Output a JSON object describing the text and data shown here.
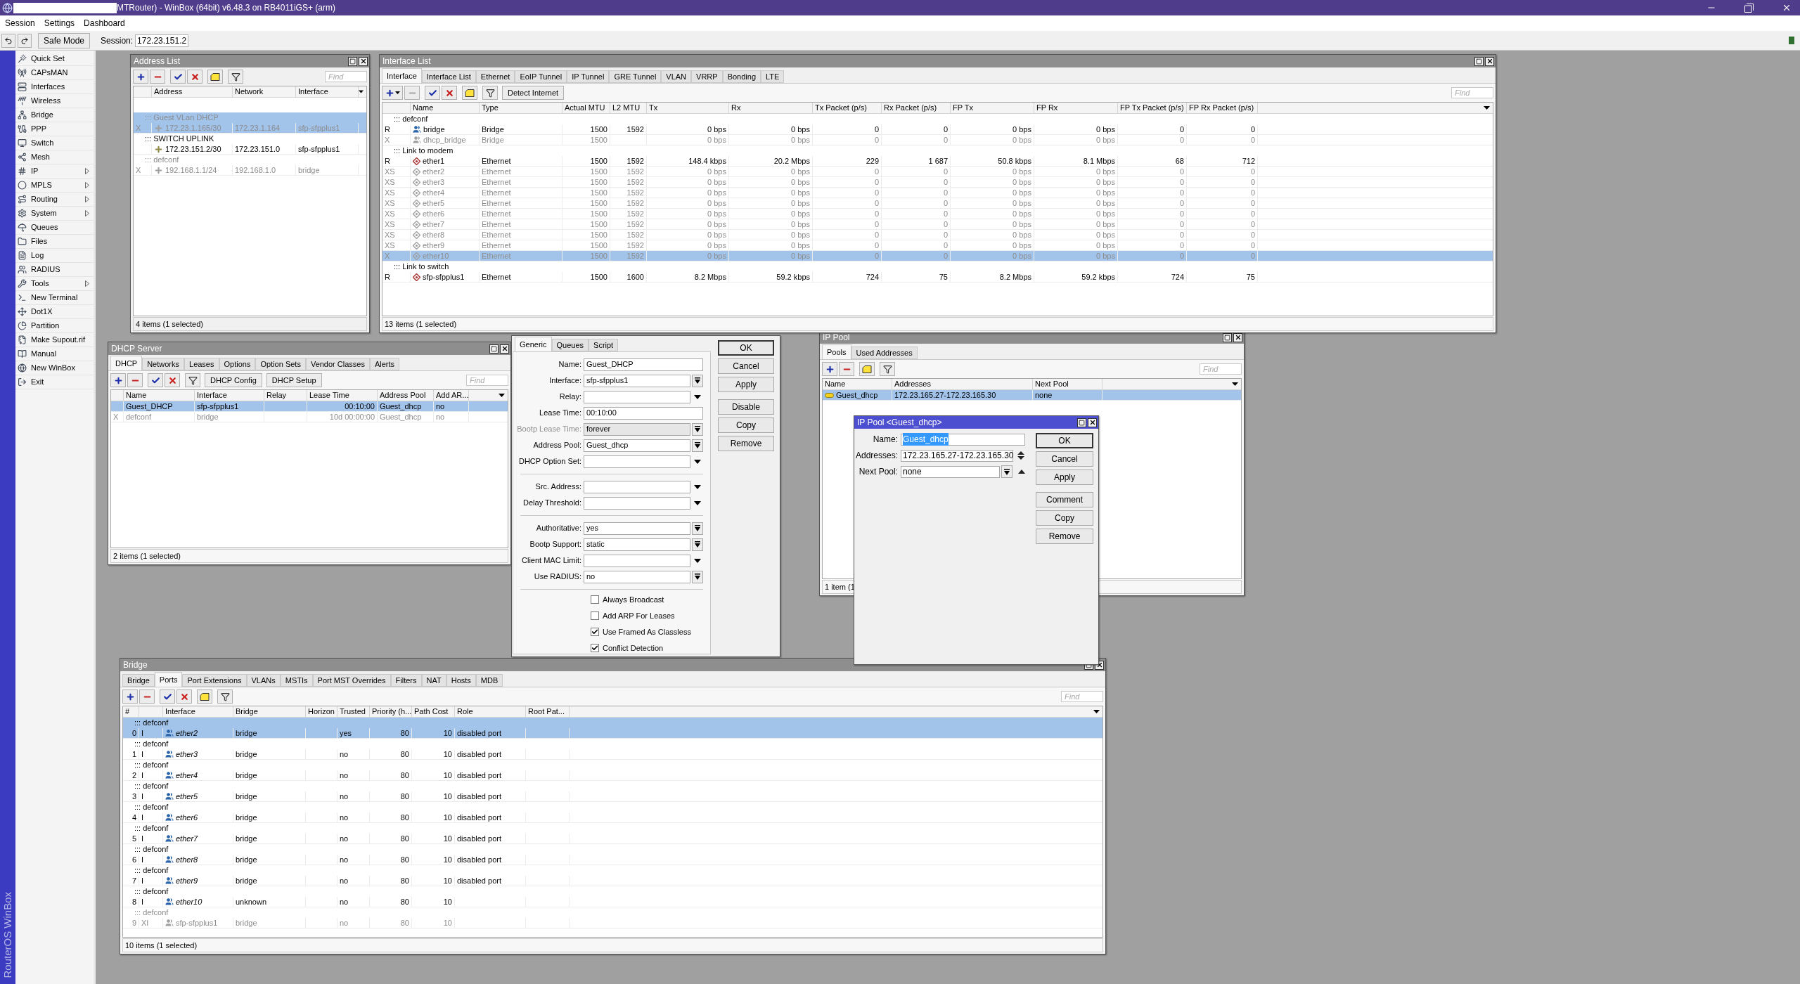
{
  "window": {
    "title": "MTRouter) - WinBox (64bit) v6.48.3 on RB4011iGS+ (arm)"
  },
  "menu": [
    "Session",
    "Settings",
    "Dashboard"
  ],
  "toolbar": {
    "safe_mode": "Safe Mode",
    "session_label": "Session:",
    "session": "172.23.151.2"
  },
  "sidebar": {
    "brand": "RouterOS WinBox",
    "items": [
      {
        "label": "Quick Set",
        "submenu": false
      },
      {
        "label": "CAPsMAN",
        "submenu": false
      },
      {
        "label": "Interfaces",
        "submenu": false
      },
      {
        "label": "Wireless",
        "submenu": false
      },
      {
        "label": "Bridge",
        "submenu": false
      },
      {
        "label": "PPP",
        "submenu": false
      },
      {
        "label": "Switch",
        "submenu": false
      },
      {
        "label": "Mesh",
        "submenu": false
      },
      {
        "label": "IP",
        "submenu": true
      },
      {
        "label": "MPLS",
        "submenu": true
      },
      {
        "label": "Routing",
        "submenu": true
      },
      {
        "label": "System",
        "submenu": true
      },
      {
        "label": "Queues",
        "submenu": false
      },
      {
        "label": "Files",
        "submenu": false
      },
      {
        "label": "Log",
        "submenu": false
      },
      {
        "label": "RADIUS",
        "submenu": false
      },
      {
        "label": "Tools",
        "submenu": true
      },
      {
        "label": "New Terminal",
        "submenu": false
      },
      {
        "label": "Dot1X",
        "submenu": false
      },
      {
        "label": "Partition",
        "submenu": false
      },
      {
        "label": "Make Supout.rif",
        "submenu": false
      },
      {
        "label": "Manual",
        "submenu": false
      },
      {
        "label": "New WinBox",
        "submenu": false
      },
      {
        "label": "Exit",
        "submenu": false
      }
    ]
  },
  "address_list": {
    "title": "Address List",
    "tools": [
      {
        "kind": "add",
        "disabled": false
      },
      {
        "kind": "remove",
        "disabled": false
      },
      {
        "kind": "enable",
        "disabled": false
      },
      {
        "kind": "disable",
        "disabled": false
      },
      {
        "kind": "comment",
        "disabled": false
      },
      {
        "kind": "filter",
        "disabled": false
      }
    ],
    "find": {
      "placeholder": "Find"
    },
    "table": {
      "columns": [
        "Address",
        "Network",
        "Interface"
      ],
      "rows": [
        {
          "kind": "address",
          "flag": "X",
          "comment": "::: Guest VLan DHCP",
          "cells": [
            "172.23.1.165/30",
            "172.23.1.164",
            "sfp-sfpplus1"
          ],
          "selected": true,
          "disabled": true
        },
        {
          "kind": "address",
          "comment": "::: SWITCH UPLINK",
          "cells": [
            "172.23.151.2/30",
            "172.23.151.0",
            "sfp-sfpplus1"
          ],
          "selected": false,
          "disabled": false
        },
        {
          "kind": "address",
          "flag": "X",
          "comment": "::: defconf",
          "cells": [
            "192.168.1.1/24",
            "192.168.1.0",
            "bridge"
          ],
          "selected": false,
          "disabled": true
        }
      ]
    },
    "status": "4 items (1 selected)"
  },
  "interface_list": {
    "title": "Interface List",
    "tabs": [
      {
        "label": "Interface",
        "selected": true
      },
      {
        "label": "Interface List",
        "selected": false
      },
      {
        "label": "Ethernet",
        "selected": false
      },
      {
        "label": "EoIP Tunnel",
        "selected": false
      },
      {
        "label": "IP Tunnel",
        "selected": false
      },
      {
        "label": "GRE Tunnel",
        "selected": false
      },
      {
        "label": "VLAN",
        "selected": false
      },
      {
        "label": "VRRP",
        "selected": false
      },
      {
        "label": "Bonding",
        "selected": false
      },
      {
        "label": "LTE",
        "selected": false
      }
    ],
    "tools": [
      {
        "kind": "add-menu",
        "disabled": false
      },
      {
        "kind": "remove",
        "disabled": true
      },
      {
        "kind": "enable",
        "disabled": false
      },
      {
        "kind": "disable",
        "disabled": false
      },
      {
        "kind": "comment",
        "disabled": false
      },
      {
        "kind": "filter",
        "disabled": false
      }
    ],
    "buttons": [
      "Detect Internet"
    ],
    "find": {
      "placeholder": "Find"
    },
    "table": {
      "columns": [
        "Name",
        "Type",
        "Actual MTU",
        "L2 MTU",
        "Tx",
        "Rx",
        "Tx Packet (p/s)",
        "Rx Packet (p/s)",
        "FP Tx",
        "FP Rx",
        "FP Tx Packet (p/s)",
        "FP Rx Packet (p/s)"
      ],
      "rows": [
        {
          "kind": "bridge",
          "flag": "R",
          "comment": "::: defconf",
          "cells": [
            "bridge",
            "Bridge",
            "1500",
            "1592",
            "0 bps",
            "0 bps",
            "0",
            "0",
            "0 bps",
            "0 bps",
            "0",
            "0"
          ],
          "selected": false,
          "disabled": false
        },
        {
          "kind": "bridge",
          "flag": "X",
          "cells": [
            "dhcp_bridge",
            "Bridge",
            "1500",
            null,
            "0 bps",
            "0 bps",
            "0",
            "0",
            "0 bps",
            "0 bps",
            "0",
            "0"
          ],
          "selected": false,
          "disabled": true
        },
        {
          "kind": "ethernet",
          "flag": "R",
          "comment": "::: Link to modem",
          "cells": [
            "ether1",
            "Ethernet",
            "1500",
            "1592",
            "148.4 kbps",
            "20.2 Mbps",
            "229",
            "1 687",
            "50.8 kbps",
            "8.1 Mbps",
            "68",
            "712"
          ],
          "selected": false,
          "disabled": false
        },
        {
          "kind": "ethernet",
          "flag": "XS",
          "cells": [
            "ether2",
            "Ethernet",
            "1500",
            "1592",
            "0 bps",
            "0 bps",
            "0",
            "0",
            "0 bps",
            "0 bps",
            "0",
            "0"
          ],
          "selected": false,
          "disabled": true
        },
        {
          "kind": "ethernet",
          "flag": "XS",
          "cells": [
            "ether3",
            "Ethernet",
            "1500",
            "1592",
            "0 bps",
            "0 bps",
            "0",
            "0",
            "0 bps",
            "0 bps",
            "0",
            "0"
          ],
          "selected": false,
          "disabled": true
        },
        {
          "kind": "ethernet",
          "flag": "XS",
          "cells": [
            "ether4",
            "Ethernet",
            "1500",
            "1592",
            "0 bps",
            "0 bps",
            "0",
            "0",
            "0 bps",
            "0 bps",
            "0",
            "0"
          ],
          "selected": false,
          "disabled": true
        },
        {
          "kind": "ethernet",
          "flag": "XS",
          "cells": [
            "ether5",
            "Ethernet",
            "1500",
            "1592",
            "0 bps",
            "0 bps",
            "0",
            "0",
            "0 bps",
            "0 bps",
            "0",
            "0"
          ],
          "selected": false,
          "disabled": true
        },
        {
          "kind": "ethernet",
          "flag": "XS",
          "cells": [
            "ether6",
            "Ethernet",
            "1500",
            "1592",
            "0 bps",
            "0 bps",
            "0",
            "0",
            "0 bps",
            "0 bps",
            "0",
            "0"
          ],
          "selected": false,
          "disabled": true
        },
        {
          "kind": "ethernet",
          "flag": "XS",
          "cells": [
            "ether7",
            "Ethernet",
            "1500",
            "1592",
            "0 bps",
            "0 bps",
            "0",
            "0",
            "0 bps",
            "0 bps",
            "0",
            "0"
          ],
          "selected": false,
          "disabled": true
        },
        {
          "kind": "ethernet",
          "flag": "XS",
          "cells": [
            "ether8",
            "Ethernet",
            "1500",
            "1592",
            "0 bps",
            "0 bps",
            "0",
            "0",
            "0 bps",
            "0 bps",
            "0",
            "0"
          ],
          "selected": false,
          "disabled": true
        },
        {
          "kind": "ethernet",
          "flag": "XS",
          "cells": [
            "ether9",
            "Ethernet",
            "1500",
            "1592",
            "0 bps",
            "0 bps",
            "0",
            "0",
            "0 bps",
            "0 bps",
            "0",
            "0"
          ],
          "selected": false,
          "disabled": true
        },
        {
          "kind": "ethernet",
          "flag": "X",
          "cells": [
            "ether10",
            "Ethernet",
            "1500",
            "1592",
            "0 bps",
            "0 bps",
            "0",
            "0",
            "0 bps",
            "0 bps",
            "0",
            "0"
          ],
          "selected": true,
          "disabled": true
        },
        {
          "kind": "ethernet",
          "flag": "R",
          "comment": "::: Link to switch",
          "cells": [
            "sfp-sfpplus1",
            "Ethernet",
            "1500",
            "1600",
            "8.2 Mbps",
            "59.2 kbps",
            "724",
            "75",
            "8.2 Mbps",
            "59.2 kbps",
            "724",
            "75"
          ],
          "selected": false,
          "disabled": false
        }
      ]
    },
    "status": "13 items (1 selected)"
  },
  "dhcp_server": {
    "title": "DHCP Server",
    "tabs": [
      {
        "label": "DHCP",
        "selected": true
      },
      {
        "label": "Networks",
        "selected": false
      },
      {
        "label": "Leases",
        "selected": false
      },
      {
        "label": "Options",
        "selected": false
      },
      {
        "label": "Option Sets",
        "selected": false
      },
      {
        "label": "Vendor Classes",
        "selected": false
      },
      {
        "label": "Alerts",
        "selected": false
      }
    ],
    "tools": [
      {
        "kind": "add",
        "disabled": false
      },
      {
        "kind": "remove",
        "disabled": false
      },
      {
        "kind": "enable",
        "disabled": false
      },
      {
        "kind": "disable",
        "disabled": false
      },
      {
        "kind": "filter",
        "disabled": false
      }
    ],
    "buttons": [
      "DHCP Config",
      "DHCP Setup"
    ],
    "find": {
      "placeholder": "Find"
    },
    "table": {
      "columns": [
        "Name",
        "Interface",
        "Relay",
        "Lease Time",
        "Address Pool",
        "Add AR..."
      ],
      "rows": [
        {
          "cells": [
            "Guest_DHCP",
            "sfp-sfpplus1",
            null,
            "00:10:00",
            "Guest_dhcp",
            "no"
          ],
          "selected": true,
          "disabled": false
        },
        {
          "flag": "X",
          "cells": [
            "defconf",
            "bridge",
            null,
            "10d 00:00:00",
            "Guest_dhcp",
            "no"
          ],
          "selected": false,
          "disabled": true
        }
      ]
    },
    "status": "2 items (1 selected)"
  },
  "dhcp_server_dialog": {
    "tabs": [
      {
        "label": "Generic",
        "selected": true
      },
      {
        "label": "Queues",
        "selected": false
      },
      {
        "label": "Script",
        "selected": false
      }
    ],
    "field_groups": [
      [
        {
          "label": "Name:",
          "value": "Guest_DHCP",
          "kind": "text",
          "disabled": false
        },
        {
          "label": "Interface:",
          "value": "sfp-sfpplus1",
          "kind": "combo",
          "disabled": false
        },
        {
          "label": "Relay:",
          "kind": "select",
          "disabled": false
        },
        {
          "label": "Lease Time:",
          "value": "00:10:00",
          "kind": "text",
          "disabled": false
        },
        {
          "label": "Bootp Lease Time:",
          "value": "forever",
          "kind": "combo",
          "disabled": true
        },
        {
          "label": "Address Pool:",
          "value": "Guest_dhcp",
          "kind": "combo",
          "disabled": false
        },
        {
          "label": "DHCP Option Set:",
          "kind": "select",
          "disabled": false
        }
      ],
      [
        {
          "label": "Src. Address:",
          "kind": "select",
          "disabled": false
        },
        {
          "label": "Delay Threshold:",
          "kind": "select",
          "disabled": false
        }
      ],
      [
        {
          "label": "Authoritative:",
          "value": "yes",
          "kind": "combo",
          "disabled": false
        },
        {
          "label": "Bootp Support:",
          "value": "static",
          "kind": "combo",
          "disabled": false
        },
        {
          "label": "Client MAC Limit:",
          "kind": "select",
          "disabled": false
        },
        {
          "label": "Use RADIUS:",
          "value": "no",
          "kind": "combo",
          "disabled": false
        }
      ]
    ],
    "checkboxes": [
      {
        "label": "Always Broadcast",
        "checked": false
      },
      {
        "label": "Add ARP For Leases",
        "checked": false
      },
      {
        "label": "Use Framed As Classless",
        "checked": true
      },
      {
        "label": "Conflict Detection",
        "checked": true
      }
    ],
    "buttons": [
      "OK",
      "Cancel",
      "Apply",
      "Disable",
      "Copy",
      "Remove"
    ]
  },
  "ip_pool": {
    "title": "IP Pool",
    "tabs": [
      {
        "label": "Pools",
        "selected": true
      },
      {
        "label": "Used Addresses",
        "selected": false
      }
    ],
    "tools": [
      {
        "kind": "add",
        "disabled": false
      },
      {
        "kind": "remove",
        "disabled": false
      },
      {
        "kind": "comment",
        "disabled": false
      },
      {
        "kind": "filter",
        "disabled": false
      }
    ],
    "find": {
      "placeholder": "Find"
    },
    "table": {
      "columns": [
        "Name",
        "Addresses",
        "Next Pool"
      ],
      "rows": [
        {
          "kind": "pool",
          "cells": [
            "Guest_dhcp",
            "172.23.165.27-172.23.165.30",
            "none"
          ],
          "selected": true,
          "disabled": false
        }
      ]
    },
    "status": "1 item (1"
  },
  "bridge": {
    "title": "Bridge",
    "tabs": [
      {
        "label": "Bridge",
        "selected": false
      },
      {
        "label": "Ports",
        "selected": true
      },
      {
        "label": "Port Extensions",
        "selected": false
      },
      {
        "label": "VLANs",
        "selected": false
      },
      {
        "label": "MSTIs",
        "selected": false
      },
      {
        "label": "Port MST Overrides",
        "selected": false
      },
      {
        "label": "Filters",
        "selected": false
      },
      {
        "label": "NAT",
        "selected": false
      },
      {
        "label": "Hosts",
        "selected": false
      },
      {
        "label": "MDB",
        "selected": false
      }
    ],
    "tools": [
      {
        "kind": "add",
        "disabled": false
      },
      {
        "kind": "remove",
        "disabled": false
      },
      {
        "kind": "enable",
        "disabled": false
      },
      {
        "kind": "disable",
        "disabled": false
      },
      {
        "kind": "comment",
        "disabled": false
      },
      {
        "kind": "filter",
        "disabled": false
      }
    ],
    "find": {
      "placeholder": "Find"
    },
    "table": {
      "columns": [
        "#",
        "Interface",
        "Bridge",
        "Horizon",
        "Trusted",
        "Priority (h...",
        "Path Cost",
        "Role",
        "Root Pat..."
      ],
      "rows": [
        {
          "kind": "bridge",
          "flag": "I",
          "comment": "::: defconf",
          "cells": [
            "0",
            "ether2",
            "bridge",
            null,
            "yes",
            "80",
            "10",
            "disabled port",
            null
          ],
          "selected": true,
          "disabled": false,
          "inactive": true
        },
        {
          "kind": "bridge",
          "flag": "I",
          "comment": "::: defconf",
          "cells": [
            "1",
            "ether3",
            "bridge",
            null,
            "no",
            "80",
            "10",
            "disabled port",
            null
          ],
          "selected": false,
          "disabled": false,
          "inactive": true
        },
        {
          "kind": "bridge",
          "flag": "I",
          "comment": "::: defconf",
          "cells": [
            "2",
            "ether4",
            "bridge",
            null,
            "no",
            "80",
            "10",
            "disabled port",
            null
          ],
          "selected": false,
          "disabled": false,
          "inactive": true
        },
        {
          "kind": "bridge",
          "flag": "I",
          "comment": "::: defconf",
          "cells": [
            "3",
            "ether5",
            "bridge",
            null,
            "no",
            "80",
            "10",
            "disabled port",
            null
          ],
          "selected": false,
          "disabled": false,
          "inactive": true
        },
        {
          "kind": "bridge",
          "flag": "I",
          "comment": "::: defconf",
          "cells": [
            "4",
            "ether6",
            "bridge",
            null,
            "no",
            "80",
            "10",
            "disabled port",
            null
          ],
          "selected": false,
          "disabled": false,
          "inactive": true
        },
        {
          "kind": "bridge",
          "flag": "I",
          "comment": "::: defconf",
          "cells": [
            "5",
            "ether7",
            "bridge",
            null,
            "no",
            "80",
            "10",
            "disabled port",
            null
          ],
          "selected": false,
          "disabled": false,
          "inactive": true
        },
        {
          "kind": "bridge",
          "flag": "I",
          "comment": "::: defconf",
          "cells": [
            "6",
            "ether8",
            "bridge",
            null,
            "no",
            "80",
            "10",
            "disabled port",
            null
          ],
          "selected": false,
          "disabled": false,
          "inactive": true
        },
        {
          "kind": "bridge",
          "flag": "I",
          "comment": "::: defconf",
          "cells": [
            "7",
            "ether9",
            "bridge",
            null,
            "no",
            "80",
            "10",
            "disabled port",
            null
          ],
          "selected": false,
          "disabled": false,
          "inactive": true
        },
        {
          "kind": "bridge",
          "flag": "I",
          "comment": "::: defconf",
          "cells": [
            "8",
            "ether10",
            "unknown",
            null,
            "no",
            "80",
            "10",
            null,
            null
          ],
          "selected": false,
          "disabled": false,
          "inactive": true
        },
        {
          "kind": "bridge",
          "flag": "XI",
          "comment": "::: defconf",
          "cells": [
            "9",
            "sfp-sfpplus1",
            "bridge",
            null,
            "no",
            "80",
            "10",
            null,
            null
          ],
          "selected": false,
          "disabled": true,
          "inactive": false
        }
      ]
    },
    "status": "10 items (1 selected)"
  },
  "ip_pool_dialog": {
    "title": "IP Pool <Guest_dhcp>",
    "fields": [
      {
        "label": "Name:",
        "value": "Guest_dhcp",
        "kind": "text",
        "selected": true
      },
      {
        "label": "Addresses:",
        "value": "172.23.165.27-172.23.165.30",
        "kind": "spin",
        "selected": false
      },
      {
        "label": "Next Pool:",
        "value": "none",
        "kind": "combo-up",
        "selected": false
      }
    ],
    "buttons": [
      "OK",
      "Cancel",
      "Apply",
      "Comment",
      "Copy",
      "Remove"
    ]
  }
}
